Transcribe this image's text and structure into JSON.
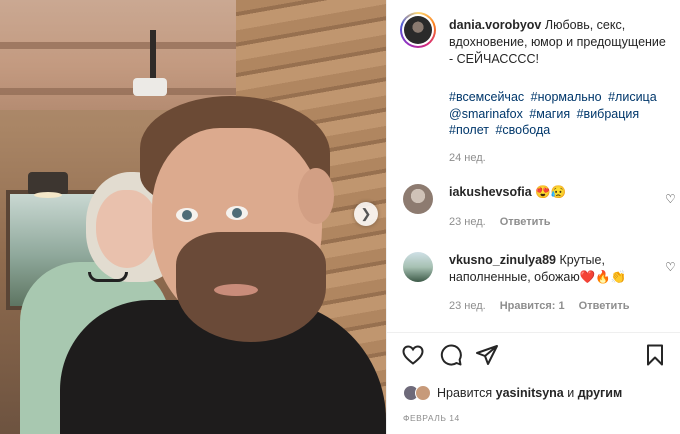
{
  "post": {
    "username": "dania.vorobyov",
    "caption": "Любовь, секс, вдохновение, юмор и предощущение - СЕЙЧАСССС!",
    "hashtags": [
      "#всемсейчас",
      "#нормально",
      "#лисица",
      "@smarinafox",
      "#магия",
      "#вибрация",
      "#полет",
      "#свобода"
    ],
    "time": "24 нед."
  },
  "comments": [
    {
      "username": "iakushevsofia",
      "text": "😍😥",
      "time": "23 нед.",
      "reply_label": "Ответить",
      "likes_label": ""
    },
    {
      "username": "vkusno_zinulya89",
      "text": "Крутые, наполненные, обожаю❤️🔥👏",
      "time": "23 нед.",
      "likes_label": "Нравится: 1",
      "reply_label": "Ответить"
    }
  ],
  "likes": {
    "prefix": "Нравится",
    "user": "yasinitsyna",
    "conjunction": "и",
    "others": "другим"
  },
  "date": "ФЕВРАЛЬ 14",
  "icons": {
    "like": "heart-icon",
    "comment": "comment-icon",
    "share": "share-icon",
    "save": "bookmark-icon",
    "next": "chevron-right-icon"
  }
}
